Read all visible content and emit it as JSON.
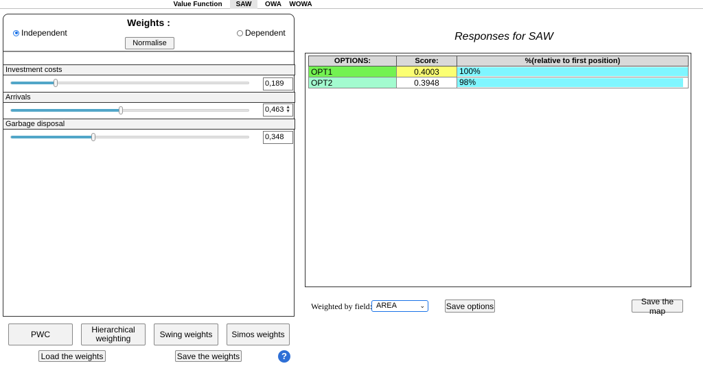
{
  "tabs": [
    {
      "label": "Value Function",
      "active": false
    },
    {
      "label": "SAW",
      "active": true
    },
    {
      "label": "OWA",
      "active": false
    },
    {
      "label": "WOWA",
      "active": false
    }
  ],
  "weights_panel": {
    "title": "Weights :",
    "independent_label": "Independent",
    "dependent_label": "Dependent",
    "selected_mode": "Independent",
    "normalise_label": "Normalise",
    "criteria": [
      {
        "name": "Investment costs",
        "value": "0,189",
        "weight": 0.189
      },
      {
        "name": "Arrivals",
        "value": "0,463",
        "weight": 0.463
      },
      {
        "name": "Garbage disposal",
        "value": "0,348",
        "weight": 0.348
      }
    ]
  },
  "bottom_buttons": {
    "pwc": "PWC",
    "hierarchical": "Hierarchical weighting",
    "swing": "Swing weights",
    "simos": "Simos weights",
    "load": "Load the weights",
    "save": "Save the weights",
    "help": "?"
  },
  "results": {
    "title": "Responses for SAW",
    "headers": [
      "OPTIONS:",
      "Score:",
      "%(relative to first position)"
    ],
    "rows": [
      {
        "option": "OPT1",
        "score": "0.4003",
        "percent_label": "100%",
        "percent": 100,
        "option_color": "#73f251",
        "score_color": "#fbff73"
      },
      {
        "option": "OPT2",
        "score": "0.3948",
        "percent_label": " 98%",
        "percent": 98,
        "option_color": "#a3fbcf",
        "score_color": "#ffffff"
      }
    ],
    "bar_color": "#7ff6ff"
  },
  "footer": {
    "weighted_label": "Weighted by field:",
    "field_value": "AREA",
    "save_options": "Save options",
    "save_map": "Save the map"
  }
}
